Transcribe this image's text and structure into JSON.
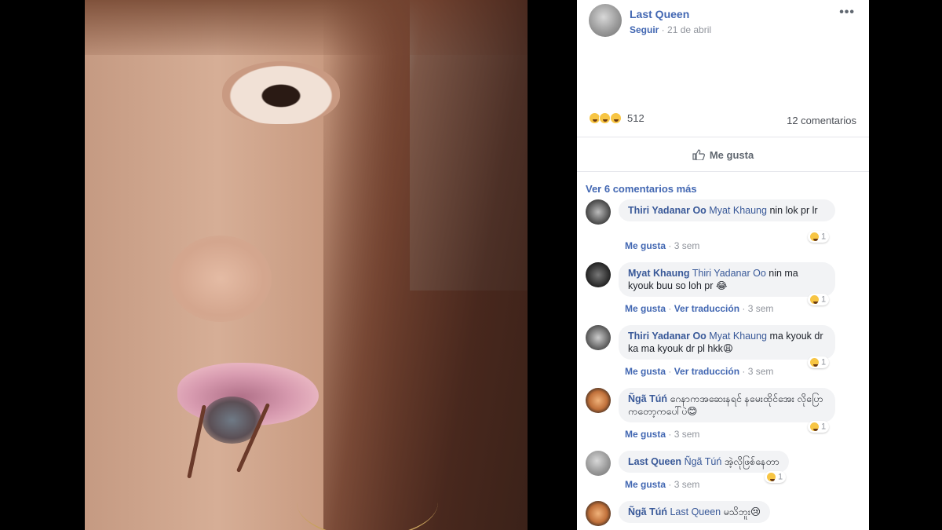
{
  "post": {
    "author": "Last Queen",
    "follow_label": "Seguir",
    "separator": " · ",
    "date": "21 de abril",
    "more_label": "•••",
    "reaction_count": "512",
    "comment_count": "12 comentarios",
    "like_label": "Me gusta",
    "view_more_label": "Ver 6 comentarios más"
  },
  "comments": [
    {
      "name": "Thiri Yadanar Oo",
      "tag": "Myat Khaung",
      "text": " nin lok pr lr",
      "like_label": "Me gusta",
      "translate_label": "",
      "time": "3 sem",
      "reactions": "1"
    },
    {
      "name": "Myat Khaung",
      "tag": "Thiri Yadanar Oo",
      "text": " nin ma kyouk buu so loh pr 😂",
      "like_label": "Me gusta",
      "translate_label": "Ver traducción",
      "time": "3 sem",
      "reactions": "1"
    },
    {
      "name": "Thiri Yadanar Oo",
      "tag": "Myat Khaung",
      "text": " ma kyouk dr ka ma kyouk dr pl hkk😩",
      "like_label": "Me gusta",
      "translate_label": "Ver traducción",
      "time": "3 sem",
      "reactions": "1"
    },
    {
      "name": "Ñgã Túń",
      "tag": "",
      "text": " ဂေနာကအဆေးနရင် နမေးထိုင်အေး လိုပြောကတော့ကပေါ်ပဲ😊",
      "like_label": "Me gusta",
      "translate_label": "",
      "time": "3 sem",
      "reactions": "1"
    },
    {
      "name": "Last Queen",
      "tag": "Ñgã Túń",
      "text": " အဲ့လိုဖြစ်နေတာ",
      "like_label": "Me gusta",
      "translate_label": "",
      "time": "3 sem",
      "reactions": "1"
    },
    {
      "name": "Ñgã Túń",
      "tag": "Last Queen",
      "text": " မသိဘူး😢",
      "like_label": "",
      "translate_label": "",
      "time": "",
      "reactions": ""
    }
  ],
  "colors": {
    "link": "#385898",
    "accent": "#4267b2",
    "muted": "#90949c"
  }
}
